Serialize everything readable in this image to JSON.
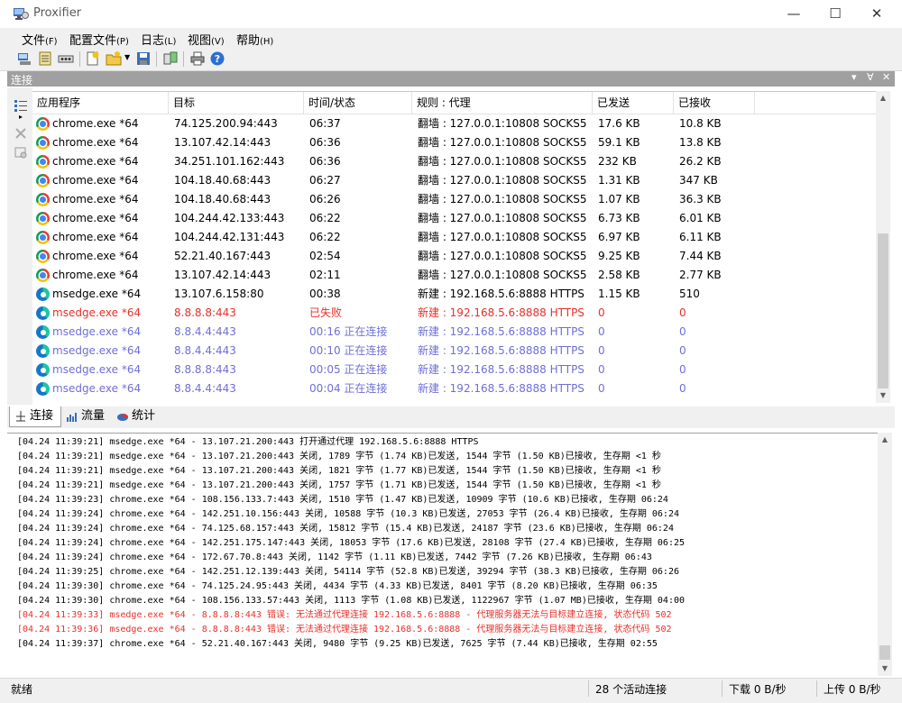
{
  "window": {
    "title": "Proxifier"
  },
  "menu": [
    {
      "label": "文件",
      "acc": "(F)"
    },
    {
      "label": "配置文件",
      "acc": "(P)"
    },
    {
      "label": "日志",
      "acc": "(L)"
    },
    {
      "label": "视图",
      "acc": "(V)"
    },
    {
      "label": "帮助",
      "acc": "(H)"
    }
  ],
  "panel": {
    "title": "连接"
  },
  "columns": [
    "应用程序",
    "目标",
    "时间/状态",
    "规则 : 代理",
    "已发送",
    "已接收"
  ],
  "rows": [
    {
      "app": "chrome.exe *64",
      "icon": "chrome",
      "target": "74.125.200.94:443",
      "time": "06:37",
      "rule": "翻墙 : 127.0.0.1:10808 SOCKS5",
      "sent": "17.6 KB",
      "recv": "10.8 KB",
      "state": "normal"
    },
    {
      "app": "chrome.exe *64",
      "icon": "chrome",
      "target": "13.107.42.14:443",
      "time": "06:36",
      "rule": "翻墙 : 127.0.0.1:10808 SOCKS5",
      "sent": "59.1 KB",
      "recv": "13.8 KB",
      "state": "normal"
    },
    {
      "app": "chrome.exe *64",
      "icon": "chrome",
      "target": "34.251.101.162:443",
      "time": "06:36",
      "rule": "翻墙 : 127.0.0.1:10808 SOCKS5",
      "sent": "232 KB",
      "recv": "26.2 KB",
      "state": "normal"
    },
    {
      "app": "chrome.exe *64",
      "icon": "chrome",
      "target": "104.18.40.68:443",
      "time": "06:27",
      "rule": "翻墙 : 127.0.0.1:10808 SOCKS5",
      "sent": "1.31 KB",
      "recv": "347 KB",
      "state": "normal"
    },
    {
      "app": "chrome.exe *64",
      "icon": "chrome",
      "target": "104.18.40.68:443",
      "time": "06:26",
      "rule": "翻墙 : 127.0.0.1:10808 SOCKS5",
      "sent": "1.07 KB",
      "recv": "36.3 KB",
      "state": "normal"
    },
    {
      "app": "chrome.exe *64",
      "icon": "chrome",
      "target": "104.244.42.133:443",
      "time": "06:22",
      "rule": "翻墙 : 127.0.0.1:10808 SOCKS5",
      "sent": "6.73 KB",
      "recv": "6.01 KB",
      "state": "normal"
    },
    {
      "app": "chrome.exe *64",
      "icon": "chrome",
      "target": "104.244.42.131:443",
      "time": "06:22",
      "rule": "翻墙 : 127.0.0.1:10808 SOCKS5",
      "sent": "6.97 KB",
      "recv": "6.11 KB",
      "state": "normal"
    },
    {
      "app": "chrome.exe *64",
      "icon": "chrome",
      "target": "52.21.40.167:443",
      "time": "02:54",
      "rule": "翻墙 : 127.0.0.1:10808 SOCKS5",
      "sent": "9.25 KB",
      "recv": "7.44 KB",
      "state": "normal"
    },
    {
      "app": "chrome.exe *64",
      "icon": "chrome",
      "target": "13.107.42.14:443",
      "time": "02:11",
      "rule": "翻墙 : 127.0.0.1:10808 SOCKS5",
      "sent": "2.58 KB",
      "recv": "2.77 KB",
      "state": "normal"
    },
    {
      "app": "msedge.exe *64",
      "icon": "edge",
      "target": "13.107.6.158:80",
      "time": "00:38",
      "rule": "新建 : 192.168.5.6:8888 HTTPS",
      "sent": "1.15 KB",
      "recv": "510",
      "state": "normal"
    },
    {
      "app": "msedge.exe *64",
      "icon": "edge",
      "target": "8.8.8.8:443",
      "time": "已失败",
      "rule": "新建 : 192.168.5.6:8888 HTTPS",
      "sent": "0",
      "recv": "0",
      "state": "error"
    },
    {
      "app": "msedge.exe *64",
      "icon": "edge",
      "target": "8.8.4.4:443",
      "time": "00:16 正在连接",
      "rule": "新建 : 192.168.5.6:8888 HTTPS",
      "sent": "0",
      "recv": "0",
      "state": "connecting"
    },
    {
      "app": "msedge.exe *64",
      "icon": "edge",
      "target": "8.8.4.4:443",
      "time": "00:10 正在连接",
      "rule": "新建 : 192.168.5.6:8888 HTTPS",
      "sent": "0",
      "recv": "0",
      "state": "connecting"
    },
    {
      "app": "msedge.exe *64",
      "icon": "edge",
      "target": "8.8.8.8:443",
      "time": "00:05 正在连接",
      "rule": "新建 : 192.168.5.6:8888 HTTPS",
      "sent": "0",
      "recv": "0",
      "state": "connecting"
    },
    {
      "app": "msedge.exe *64",
      "icon": "edge",
      "target": "8.8.4.4:443",
      "time": "00:04 正在连接",
      "rule": "新建 : 192.168.5.6:8888 HTTPS",
      "sent": "0",
      "recv": "0",
      "state": "connecting"
    }
  ],
  "tabs": [
    {
      "label": "连接",
      "icon": "connection-icon",
      "active": true
    },
    {
      "label": "流量",
      "icon": "traffic-chart-icon",
      "active": false
    },
    {
      "label": "统计",
      "icon": "statistics-pie-icon",
      "active": false
    }
  ],
  "log": [
    {
      "text": "[04.24 11:39:21] msedge.exe *64 - 13.107.21.200:443 打开通过代理 192.168.5.6:8888 HTTPS",
      "level": "info"
    },
    {
      "text": "[04.24 11:39:21] msedge.exe *64 - 13.107.21.200:443 关闭, 1789 字节 (1.74 KB)已发送, 1544 字节 (1.50 KB)已接收, 生存期 <1 秒",
      "level": "info"
    },
    {
      "text": "[04.24 11:39:21] msedge.exe *64 - 13.107.21.200:443 关闭, 1821 字节 (1.77 KB)已发送, 1544 字节 (1.50 KB)已接收, 生存期 <1 秒",
      "level": "info"
    },
    {
      "text": "[04.24 11:39:21] msedge.exe *64 - 13.107.21.200:443 关闭, 1757 字节 (1.71 KB)已发送, 1544 字节 (1.50 KB)已接收, 生存期 <1 秒",
      "level": "info"
    },
    {
      "text": "[04.24 11:39:23] chrome.exe *64 - 108.156.133.7:443 关闭, 1510 字节 (1.47 KB)已发送, 10909 字节 (10.6 KB)已接收, 生存期 06:24",
      "level": "info"
    },
    {
      "text": "[04.24 11:39:24] chrome.exe *64 - 142.251.10.156:443 关闭, 10588 字节 (10.3 KB)已发送, 27053 字节 (26.4 KB)已接收, 生存期 06:24",
      "level": "info"
    },
    {
      "text": "[04.24 11:39:24] chrome.exe *64 - 74.125.68.157:443 关闭, 15812 字节 (15.4 KB)已发送, 24187 字节 (23.6 KB)已接收, 生存期 06:24",
      "level": "info"
    },
    {
      "text": "[04.24 11:39:24] chrome.exe *64 - 142.251.175.147:443 关闭, 18053 字节 (17.6 KB)已发送, 28108 字节 (27.4 KB)已接收, 生存期 06:25",
      "level": "info"
    },
    {
      "text": "[04.24 11:39:24] chrome.exe *64 - 172.67.70.8:443 关闭, 1142 字节 (1.11 KB)已发送, 7442 字节 (7.26 KB)已接收, 生存期 06:43",
      "level": "info"
    },
    {
      "text": "[04.24 11:39:25] chrome.exe *64 - 142.251.12.139:443 关闭, 54114 字节 (52.8 KB)已发送, 39294 字节 (38.3 KB)已接收, 生存期 06:26",
      "level": "info"
    },
    {
      "text": "[04.24 11:39:30] chrome.exe *64 - 74.125.24.95:443 关闭, 4434 字节 (4.33 KB)已发送, 8401 字节 (8.20 KB)已接收, 生存期 06:35",
      "level": "info"
    },
    {
      "text": "[04.24 11:39:30] chrome.exe *64 - 108.156.133.57:443 关闭, 1113 字节 (1.08 KB)已发送, 1122967 字节 (1.07 MB)已接收, 生存期 04:00",
      "level": "info"
    },
    {
      "text": "[04.24 11:39:33] msedge.exe *64 - 8.8.8.8:443 错误: 无法通过代理连接 192.168.5.6:8888 - 代理服务器无法与目标建立连接, 状态代码 502",
      "level": "error"
    },
    {
      "text": "[04.24 11:39:36] msedge.exe *64 - 8.8.8.8:443 错误: 无法通过代理连接 192.168.5.6:8888 - 代理服务器无法与目标建立连接, 状态代码 502",
      "level": "error"
    },
    {
      "text": "[04.24 11:39:37] chrome.exe *64 - 52.21.40.167:443 关闭, 9480 字节 (9.25 KB)已发送, 7625 字节 (7.44 KB)已接收, 生存期 02:55",
      "level": "info"
    }
  ],
  "status": {
    "left": "就绪",
    "active_connections": "28 个活动连接",
    "download": "下载 0 B/秒",
    "upload": "上传 0 B/秒"
  },
  "colors": {
    "error": "#e8302a",
    "connecting": "#6f6fd6",
    "normal": "#000000"
  }
}
